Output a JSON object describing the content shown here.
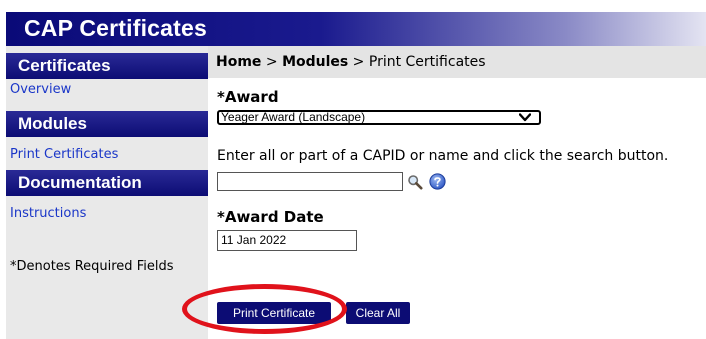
{
  "header": {
    "title": "CAP Certificates"
  },
  "sidebar": {
    "sections": [
      {
        "title": "Certificates",
        "link": "Overview"
      },
      {
        "title": "Modules",
        "link": "Print Certificates"
      },
      {
        "title": "Documentation",
        "link": "Instructions"
      }
    ],
    "required_note": "*Denotes Required Fields"
  },
  "breadcrumb": {
    "home": "Home",
    "sep1": " > ",
    "modules": "Modules",
    "sep2": " > ",
    "current": "Print Certificates"
  },
  "form": {
    "award_label": "*Award",
    "award_selected": "Yeager Award (Landscape)",
    "search_instruction": "Enter all or part of a CAPID or name and click the search button.",
    "search_value": "",
    "award_date_label": "*Award Date",
    "award_date_value": "11 Jan 2022"
  },
  "buttons": {
    "print": "Print Certificate",
    "clear": "Clear All"
  },
  "icons": {
    "search": "magnifier-icon",
    "help": "help-icon",
    "chevron": "chevron-down-icon"
  },
  "colors": {
    "brand_navy": "#0c0c74",
    "link_blue": "#1a36c8",
    "highlight_red": "#e0121b",
    "sidebar_bg": "#e9e9e9"
  }
}
